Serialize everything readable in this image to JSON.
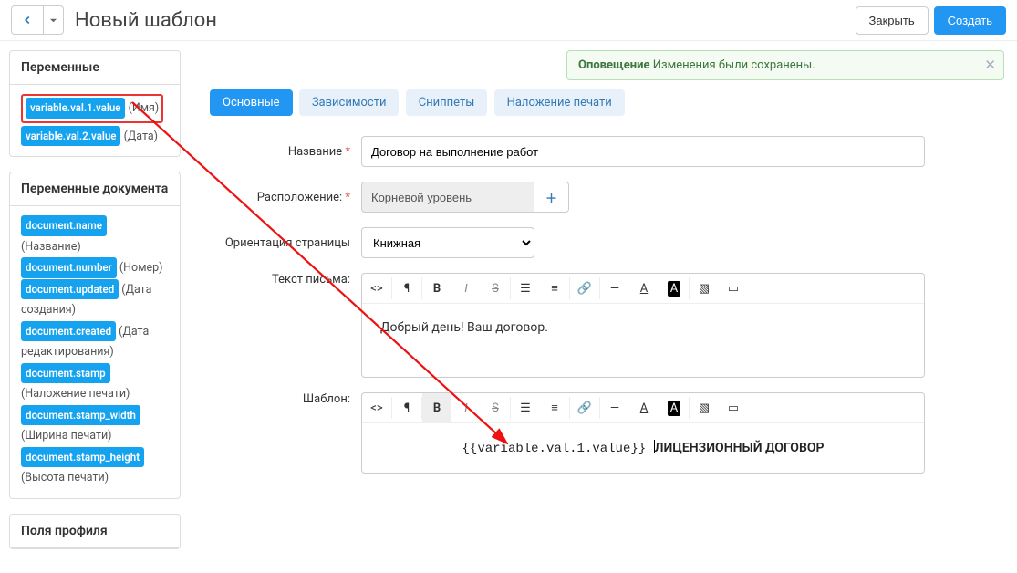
{
  "header": {
    "title": "Новый шаблон",
    "close_label": "Закрыть",
    "create_label": "Создать"
  },
  "alert": {
    "title": "Оповещение",
    "text": " Изменения были сохранены."
  },
  "sidebar": {
    "panel1": {
      "heading": "Переменные",
      "items": [
        {
          "tag": "variable.val.1.value",
          "desc": " (Имя)"
        },
        {
          "tag": "variable.val.2.value",
          "desc": " (Дата)"
        }
      ]
    },
    "panel2": {
      "heading": "Переменные документа",
      "items": [
        {
          "tag": "document.name",
          "desc": " (Название)"
        },
        {
          "tag": "document.number",
          "desc": " (Номер)"
        },
        {
          "tag": "document.updated",
          "desc": " (Дата создания)"
        },
        {
          "tag": "document.created",
          "desc": " (Дата редактирования)"
        },
        {
          "tag": "document.stamp",
          "desc": " (Наложение печати)"
        },
        {
          "tag": "document.stamp_width",
          "desc": " (Ширина печати)"
        },
        {
          "tag": "document.stamp_height",
          "desc": " (Высота печати)"
        }
      ]
    },
    "panel3": {
      "heading": "Поля профиля"
    }
  },
  "tabs": {
    "t0": "Основные",
    "t1": "Зависимости",
    "t2": "Сниппеты",
    "t3": "Наложение печати"
  },
  "form": {
    "name_label": "Название ",
    "name_value": "Договор на выполнение работ",
    "location_label": "Расположение: ",
    "location_value": "Корневой уровень",
    "orientation_label": "Ориентация страницы",
    "orientation_value": "Книжная",
    "lettertext_label": "Текст письма:",
    "lettertext_value": "Добрый день! Ваш договор.",
    "template_label": "Шаблон:",
    "template_value_var": "{{variable.val.1.value}} ",
    "template_value_text": "ЛИЦЕНЗИОННЫЙ ДОГОВОР"
  }
}
